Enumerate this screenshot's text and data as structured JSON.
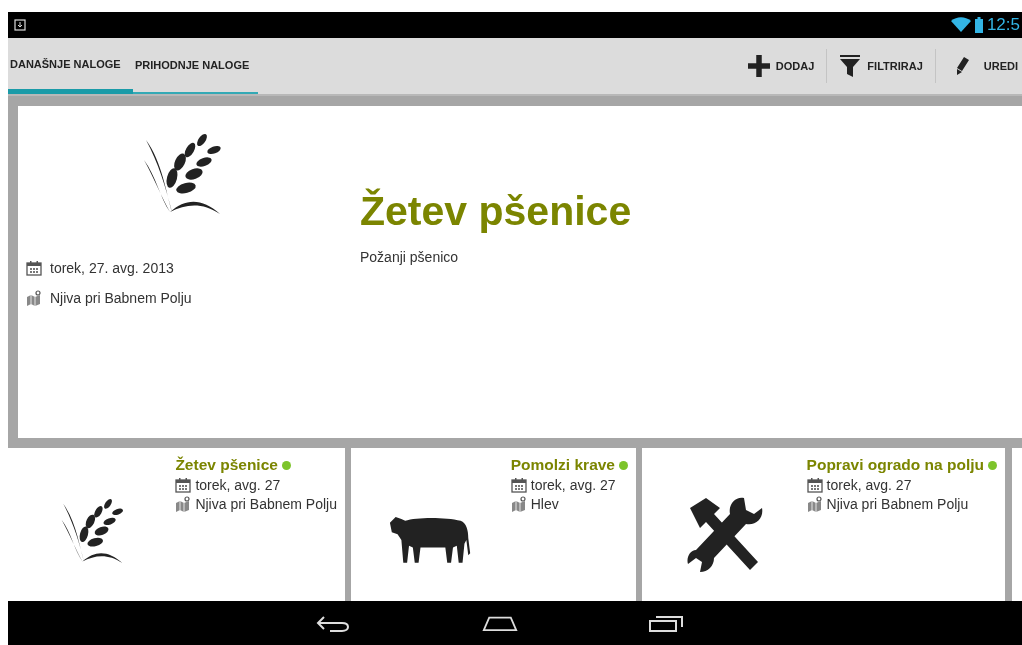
{
  "status_bar": {
    "time": "12:5"
  },
  "tabs": [
    {
      "label": "DANAŠNJE NALOGE",
      "selected": true
    },
    {
      "label": "PRIHODNJE NALOGE",
      "selected": false
    }
  ],
  "actions": [
    {
      "kind": "add",
      "label": "DODAJ"
    },
    {
      "kind": "filter",
      "label": "FILTRIRAJ"
    },
    {
      "kind": "edit",
      "label": "UREDI"
    }
  ],
  "featured": {
    "kind": "wheat",
    "title": "Žetev pšenice",
    "description": "Požanji pšenico",
    "date": "torek, 27. avg. 2013",
    "place": "Njiva pri Babnem Polju"
  },
  "tasks": [
    {
      "kind": "wheat",
      "title": "Žetev pšenice",
      "color": "#7dc42b",
      "date": "torek, avg. 27",
      "place": "Njiva pri Babnem Polju"
    },
    {
      "kind": "cow",
      "title": "Pomolzi krave",
      "color": "#7dc42b",
      "date": "torek, avg. 27",
      "place": "Hlev"
    },
    {
      "kind": "tools",
      "title": "Popravi ogrado na polju",
      "color": "#7dc42b",
      "date": "torek, avg. 27",
      "place": "Njiva pri Babnem Polju"
    }
  ]
}
